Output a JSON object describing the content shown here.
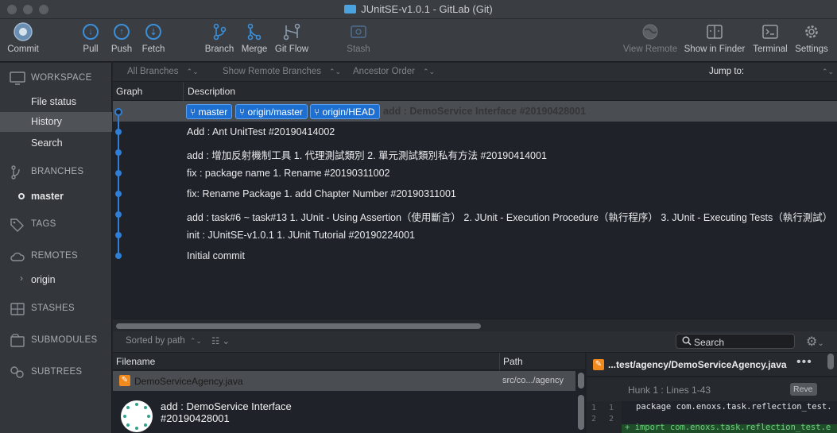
{
  "window": {
    "title": "JUnitSE-v1.0.1 - GitLab (Git)"
  },
  "toolbar": {
    "commit": "Commit",
    "pull": "Pull",
    "push": "Push",
    "fetch": "Fetch",
    "branch": "Branch",
    "merge": "Merge",
    "gitflow": "Git Flow",
    "stash": "Stash",
    "view_remote": "View Remote",
    "show_in_finder": "Show in Finder",
    "terminal": "Terminal",
    "settings": "Settings"
  },
  "sidebar": {
    "workspace": "WORKSPACE",
    "file_status": "File status",
    "history": "History",
    "search": "Search",
    "branches": "BRANCHES",
    "master": "master",
    "tags": "TAGS",
    "remotes": "REMOTES",
    "origin": "origin",
    "stashes": "STASHES",
    "submodules": "SUBMODULES",
    "subtrees": "SUBTREES"
  },
  "filters": {
    "branches": "All Branches",
    "remote_branches": "Show Remote Branches",
    "order": "Ancestor Order",
    "jump_to": "Jump to:"
  },
  "columns": {
    "graph": "Graph",
    "description": "Description"
  },
  "commits": [
    {
      "message": "add : DemoService Interface #20190428001"
    },
    {
      "message": "Add : Ant UnitTest #20190414002"
    },
    {
      "message": "add : 增加反射機制工具 1. 代理測試類別 2. 單元測試類別私有方法 #20190414001"
    },
    {
      "message": "fix : package name 1. Rename #20190311002"
    },
    {
      "message": "fix: Rename Package 1. add Chapter Number #20190311001"
    },
    {
      "message": "add : task#6 ~ task#13 1. JUnit - Using Assertion（使用斷言） 2. JUnit - Execution Procedure（執行程序） 3. JUnit - Executing Tests（執行測試）"
    },
    {
      "message": "init : JUnitSE-v1.0.1 1. JUnit Tutorial #20190224001"
    },
    {
      "message": "Initial commit"
    }
  ],
  "refs": {
    "master": "master",
    "origin_master": "origin/master",
    "origin_head": "origin/HEAD"
  },
  "files": {
    "sorted_by": "Sorted by path",
    "search": "Search",
    "col_filename": "Filename",
    "col_path": "Path",
    "rows": [
      {
        "name": "DemoServiceAgency.java",
        "path": "src/co.../agency"
      }
    ]
  },
  "commit_info": {
    "message": "add : DemoService Interface #20190428001"
  },
  "diff": {
    "file": "...test/agency/DemoServiceAgency.java",
    "hunk": "Hunk 1 : Lines 1-43",
    "revert": "Reve",
    "line1_old": "1",
    "line1_new": "1",
    "line2_old": "2",
    "line2_new": "2",
    "code1": "package com.enoxs.task.reflection_test.",
    "code2": "+ import com.enoxs.task.reflection_test.e"
  },
  "colors": {
    "accent": "#2f7fd6",
    "ref_tag": "#1d6fd1",
    "file_icon": "#f0891e"
  }
}
